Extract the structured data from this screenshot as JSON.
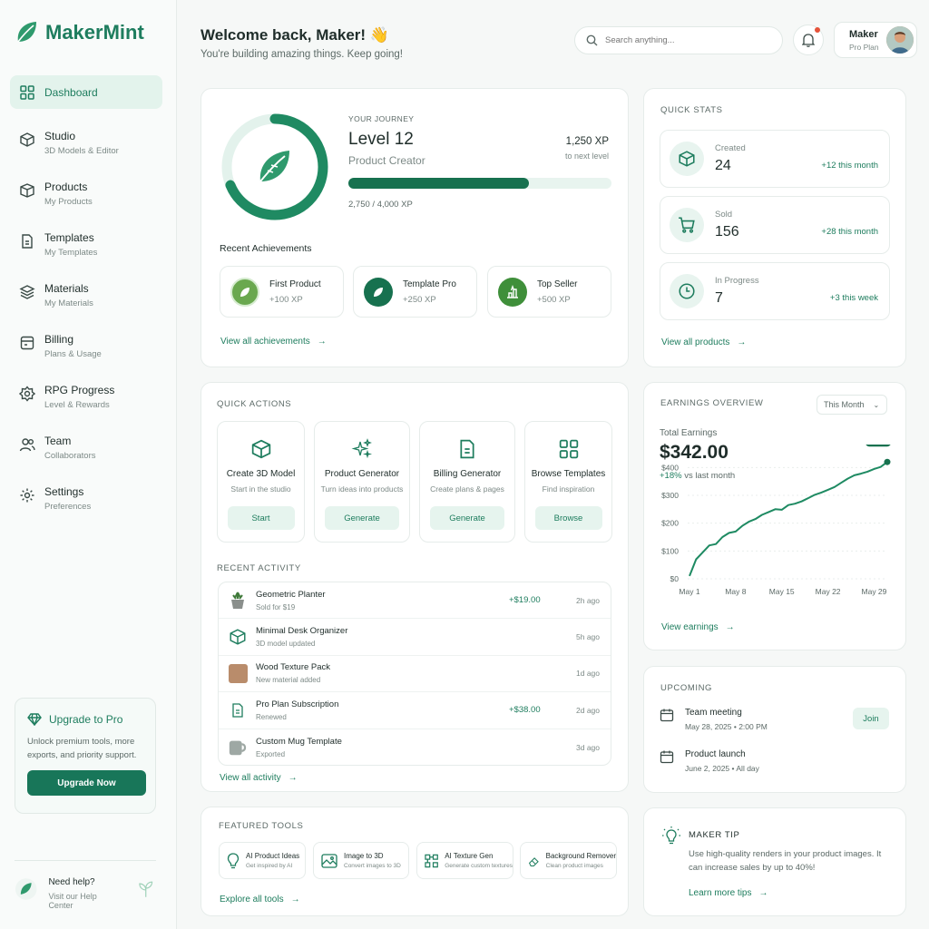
{
  "brand": {
    "name": "MakerMint",
    "accent": "#1e7d5e",
    "dark": "#187659"
  },
  "sidebar": {
    "items": [
      {
        "label": "Dashboard",
        "sub": "",
        "icon": "grid-icon"
      },
      {
        "label": "Studio",
        "sub": "3D Models & Editor",
        "icon": "cube-icon"
      },
      {
        "label": "Products",
        "sub": "My Products",
        "icon": "box-icon"
      },
      {
        "label": "Templates",
        "sub": "My Templates",
        "icon": "document-icon"
      },
      {
        "label": "Materials",
        "sub": "My Materials",
        "icon": "layers-icon"
      },
      {
        "label": "Billing",
        "sub": "Plans & Usage",
        "icon": "billing-icon"
      },
      {
        "label": "RPG Progress",
        "sub": "Level & Rewards",
        "icon": "badge-icon"
      },
      {
        "label": "Team",
        "sub": "Collaborators",
        "icon": "team-icon"
      },
      {
        "label": "Settings",
        "sub": "Preferences",
        "icon": "gear-icon"
      }
    ],
    "upgrade": {
      "title": "Upgrade to Pro",
      "text": "Unlock premium tools, more exports, and priority support.",
      "button": "Upgrade Now"
    },
    "help": {
      "title": "Need help?",
      "sub": "Visit our Help Center"
    }
  },
  "header": {
    "title": "Welcome back, Maker! 👋",
    "subtitle": "You're building amazing things. Keep going!",
    "search_placeholder": "Search anything...",
    "user_name": "Maker",
    "user_plan": "Pro Plan"
  },
  "journey": {
    "label": "YOUR JOURNEY",
    "level": "Level 12",
    "rank": "Product Creator",
    "xp_next": "1,250 XP",
    "xp_next_label": "to next level",
    "xp_count": "2,750 / 4,000 XP",
    "progress": 0.6875,
    "achievements_title": "Recent Achievements",
    "achievements": [
      {
        "name": "First Product",
        "xp": "+100 XP"
      },
      {
        "name": "Template Pro",
        "xp": "+250 XP"
      },
      {
        "name": "Top Seller",
        "xp": "+500 XP"
      }
    ],
    "view_all": "View all achievements"
  },
  "stats": {
    "label": "QUICK STATS",
    "items": [
      {
        "label": "Created",
        "value": "24",
        "delta": "+12 this month"
      },
      {
        "label": "Sold",
        "value": "156",
        "delta": "+28 this month"
      },
      {
        "label": "In Progress",
        "value": "7",
        "delta": "+3 this week"
      }
    ],
    "view_all": "View all products"
  },
  "quick_actions": {
    "label": "QUICK ACTIONS",
    "items": [
      {
        "title": "Create 3D Model",
        "sub": "Start in the studio",
        "button": "Start"
      },
      {
        "title": "Product Generator",
        "sub": "Turn ideas into products",
        "button": "Generate"
      },
      {
        "title": "Billing Generator",
        "sub": "Create plans & pages",
        "button": "Generate"
      },
      {
        "title": "Browse Templates",
        "sub": "Find inspiration",
        "button": "Browse"
      }
    ]
  },
  "activity": {
    "label": "RECENT ACTIVITY",
    "items": [
      {
        "name": "Geometric Planter",
        "sub": "Sold for $19",
        "amount": "+$19.00",
        "time": "2h ago"
      },
      {
        "name": "Minimal Desk Organizer",
        "sub": "3D model updated",
        "amount": "",
        "time": "5h ago"
      },
      {
        "name": "Wood Texture Pack",
        "sub": "New material added",
        "amount": "",
        "time": "1d ago"
      },
      {
        "name": "Pro Plan Subscription",
        "sub": "Renewed",
        "amount": "+$38.00",
        "time": "2d ago"
      },
      {
        "name": "Custom Mug Template",
        "sub": "Exported",
        "amount": "",
        "time": "3d ago"
      }
    ],
    "view_all": "View all activity"
  },
  "featured": {
    "label": "FEATURED TOOLS",
    "items": [
      {
        "name": "AI Product Ideas",
        "sub": "Get inspired by AI"
      },
      {
        "name": "Image to 3D",
        "sub": "Convert images to 3D"
      },
      {
        "name": "AI Texture Gen",
        "sub": "Generate custom textures"
      },
      {
        "name": "Background Remover",
        "sub": "Clean product images"
      }
    ],
    "explore": "Explore all tools"
  },
  "earnings": {
    "label": "EARNINGS OVERVIEW",
    "period": "This Month",
    "total_label": "Total Earnings",
    "total": "$342.00",
    "delta": "+18%",
    "delta_note": "vs last month",
    "view": "View earnings"
  },
  "chart_data": {
    "type": "line",
    "x_ticks": [
      "May 1",
      "May 8",
      "May 15",
      "May 22",
      "May 29"
    ],
    "y_ticks": [
      "$0",
      "$100",
      "$200",
      "$300",
      "$400"
    ],
    "ylim": [
      0,
      450
    ],
    "x": [
      1,
      2,
      3,
      4,
      5,
      6,
      7,
      8,
      9,
      10,
      11,
      12,
      13,
      14,
      15,
      16,
      17,
      18,
      19,
      20,
      21,
      22,
      23,
      24,
      25,
      26,
      27,
      28,
      29,
      30,
      31
    ],
    "values": [
      10,
      70,
      95,
      120,
      125,
      150,
      165,
      170,
      190,
      205,
      215,
      230,
      240,
      250,
      248,
      265,
      270,
      278,
      290,
      302,
      310,
      320,
      330,
      345,
      360,
      372,
      378,
      385,
      395,
      402,
      420
    ],
    "end_label": "$342"
  },
  "upcoming": {
    "label": "UPCOMING",
    "items": [
      {
        "title": "Team meeting",
        "sub": "May 28, 2025 • 2:00 PM",
        "action": "Join"
      },
      {
        "title": "Product launch",
        "sub": "June 2, 2025 • All day"
      }
    ]
  },
  "tip": {
    "label": "MAKER TIP",
    "text": "Use high-quality renders in your product images. It can increase sales by up to 40%!",
    "link": "Learn more tips"
  }
}
